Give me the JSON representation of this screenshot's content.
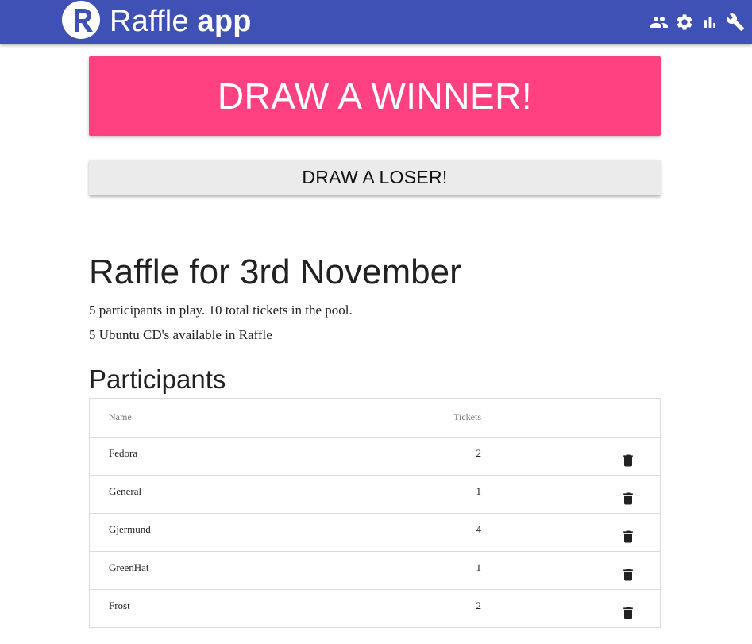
{
  "appbar": {
    "brand_light": "Raffle",
    "brand_bold": "app",
    "icons": [
      "people-icon",
      "settings-icon",
      "bar-chart-icon",
      "wrench-icon"
    ],
    "color": "#3f51b5"
  },
  "actions": {
    "winner_label": "DRAW A WINNER!",
    "loser_label": "DRAW A LOSER!",
    "winner_color": "#ff4081"
  },
  "raffle": {
    "title": "Raffle for 3rd November",
    "summary": "5 participants in play. 10 total tickets in the pool.",
    "prizes": "5 Ubuntu CD's available in Raffle"
  },
  "participants": {
    "heading": "Participants",
    "columns": {
      "name": "Name",
      "tickets": "Tickets"
    },
    "rows": [
      {
        "name": "Fedora",
        "tickets": "2"
      },
      {
        "name": "General",
        "tickets": "1"
      },
      {
        "name": "Gjermund",
        "tickets": "4"
      },
      {
        "name": "GreenHat",
        "tickets": "1"
      },
      {
        "name": "Frost",
        "tickets": "2"
      }
    ],
    "row_action_icon": "trash-icon"
  }
}
